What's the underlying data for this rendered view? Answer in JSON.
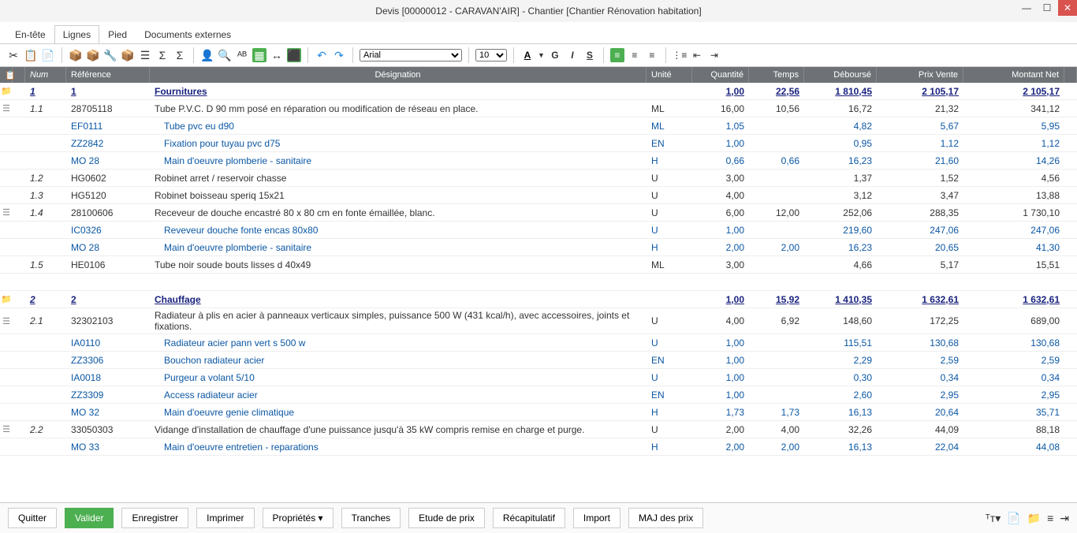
{
  "title": "Devis [00000012 - CARAVAN'AIR] - Chantier [Chantier Rénovation habitation]",
  "tabs": [
    "En-tête",
    "Lignes",
    "Pied",
    "Documents externes"
  ],
  "active_tab": 1,
  "toolbar": {
    "font": "Arial",
    "size": "10"
  },
  "columns": [
    "",
    "",
    "Num",
    "Référence",
    "Désignation",
    "Unité",
    "Quantité",
    "Temps",
    "Déboursé",
    "Prix Vente",
    "Montant Net"
  ],
  "rows": [
    {
      "type": "section",
      "icon": "folder",
      "num": "1",
      "ref": "1",
      "des": "Fournitures",
      "unit": "",
      "qty": "1,00",
      "time": "22,56",
      "deb": "1 810,45",
      "prix": "2 105,17",
      "net": "2 105,17"
    },
    {
      "type": "main",
      "icon": "doc",
      "num": "1.1",
      "ref": "28705118",
      "des": "Tube P.V.C. D 90 mm posé en réparation ou modification de réseau en place.",
      "unit": "ML",
      "qty": "16,00",
      "time": "10,56",
      "deb": "16,72",
      "prix": "21,32",
      "net": "341,12"
    },
    {
      "type": "sub",
      "num": "",
      "ref": "EF0111",
      "des": "Tube pvc eu d90",
      "unit": "ML",
      "qty": "1,05",
      "time": "",
      "deb": "4,82",
      "prix": "5,67",
      "net": "5,95"
    },
    {
      "type": "sub",
      "num": "",
      "ref": "ZZ2842",
      "des": "Fixation pour tuyau pvc d75",
      "unit": "EN",
      "qty": "1,00",
      "time": "",
      "deb": "0,95",
      "prix": "1,12",
      "net": "1,12"
    },
    {
      "type": "sub",
      "num": "",
      "ref": "MO 28",
      "des": "Main d'oeuvre plomberie - sanitaire",
      "unit": "H",
      "qty": "0,66",
      "time": "0,66",
      "deb": "16,23",
      "prix": "21,60",
      "net": "14,26"
    },
    {
      "type": "main",
      "num": "1.2",
      "ref": "HG0602",
      "des": "Robinet arret / reservoir chasse",
      "unit": "U",
      "qty": "3,00",
      "time": "",
      "deb": "1,37",
      "prix": "1,52",
      "net": "4,56"
    },
    {
      "type": "main",
      "num": "1.3",
      "ref": "HG5120",
      "des": "Robinet boisseau speriq 15x21",
      "unit": "U",
      "qty": "4,00",
      "time": "",
      "deb": "3,12",
      "prix": "3,47",
      "net": "13,88"
    },
    {
      "type": "main",
      "icon": "doc",
      "num": "1.4",
      "ref": "28100606",
      "des": "Receveur de douche encastré 80 x 80 cm en fonte émaillée, blanc.",
      "unit": "U",
      "qty": "6,00",
      "time": "12,00",
      "deb": "252,06",
      "prix": "288,35",
      "net": "1 730,10"
    },
    {
      "type": "sub",
      "num": "",
      "ref": "IC0326",
      "des": "Reveveur douche fonte encas 80x80",
      "unit": "U",
      "qty": "1,00",
      "time": "",
      "deb": "219,60",
      "prix": "247,06",
      "net": "247,06"
    },
    {
      "type": "sub",
      "num": "",
      "ref": "MO 28",
      "des": "Main d'oeuvre plomberie - sanitaire",
      "unit": "H",
      "qty": "2,00",
      "time": "2,00",
      "deb": "16,23",
      "prix": "20,65",
      "net": "41,30"
    },
    {
      "type": "main",
      "num": "1.5",
      "ref": "HE0106",
      "des": "Tube noir soude bouts lisses d 40x49",
      "unit": "ML",
      "qty": "3,00",
      "time": "",
      "deb": "4,66",
      "prix": "5,17",
      "net": "15,51"
    },
    {
      "type": "spacer"
    },
    {
      "type": "section",
      "icon": "folder",
      "num": "2",
      "ref": "2",
      "des": "Chauffage",
      "unit": "",
      "qty": "1,00",
      "time": "15,92",
      "deb": "1 410,35",
      "prix": "1 632,61",
      "net": "1 632,61"
    },
    {
      "type": "main",
      "icon": "doc",
      "num": "2.1",
      "ref": "32302103",
      "des": "Radiateur à plis en acier à panneaux verticaux simples, puissance 500 W (431 kcal/h), avec accessoires, joints et fixations.",
      "unit": "U",
      "qty": "4,00",
      "time": "6,92",
      "deb": "148,60",
      "prix": "172,25",
      "net": "689,00"
    },
    {
      "type": "sub",
      "num": "",
      "ref": "IA0110",
      "des": "Radiateur acier pann vert s 500 w",
      "unit": "U",
      "qty": "1,00",
      "time": "",
      "deb": "115,51",
      "prix": "130,68",
      "net": "130,68"
    },
    {
      "type": "sub",
      "num": "",
      "ref": "ZZ3306",
      "des": "Bouchon radiateur acier",
      "unit": "EN",
      "qty": "1,00",
      "time": "",
      "deb": "2,29",
      "prix": "2,59",
      "net": "2,59"
    },
    {
      "type": "sub",
      "num": "",
      "ref": "IA0018",
      "des": "Purgeur a volant 5/10",
      "unit": "U",
      "qty": "1,00",
      "time": "",
      "deb": "0,30",
      "prix": "0,34",
      "net": "0,34"
    },
    {
      "type": "sub",
      "num": "",
      "ref": "ZZ3309",
      "des": "Access radiateur acier",
      "unit": "EN",
      "qty": "1,00",
      "time": "",
      "deb": "2,60",
      "prix": "2,95",
      "net": "2,95"
    },
    {
      "type": "sub",
      "num": "",
      "ref": "MO 32",
      "des": "Main d'oeuvre genie climatique",
      "unit": "H",
      "qty": "1,73",
      "time": "1,73",
      "deb": "16,13",
      "prix": "20,64",
      "net": "35,71"
    },
    {
      "type": "main",
      "icon": "doc",
      "num": "2.2",
      "ref": "33050303",
      "des": "Vidange d'installation de chauffage d'une puissance jusqu'à 35 kW compris remise en charge et purge.",
      "unit": "U",
      "qty": "2,00",
      "time": "4,00",
      "deb": "32,26",
      "prix": "44,09",
      "net": "88,18"
    },
    {
      "type": "sub",
      "num": "",
      "ref": "MO 33",
      "des": "Main d'oeuvre entretien - reparations",
      "unit": "H",
      "qty": "2,00",
      "time": "2,00",
      "deb": "16,13",
      "prix": "22,04",
      "net": "44,08"
    }
  ],
  "buttons": [
    "Quitter",
    "Valider",
    "Enregistrer",
    "Imprimer",
    "Propriétés",
    "Tranches",
    "Etude de prix",
    "Récapitulatif",
    "Import",
    "MAJ des prix"
  ]
}
